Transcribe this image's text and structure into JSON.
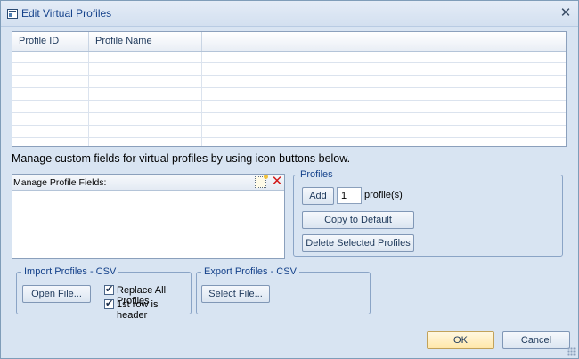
{
  "window": {
    "title": "Edit Virtual Profiles",
    "close_icon": "close-icon"
  },
  "grid": {
    "columns": [
      "Profile ID",
      "Profile Name"
    ],
    "rows": []
  },
  "caption": "Manage custom fields for virtual profiles by using icon buttons below.",
  "manage_fields": {
    "label": "Manage Profile Fields:",
    "icons": [
      "new-field-icon",
      "delete-icon"
    ]
  },
  "profiles_group": {
    "legend": "Profiles",
    "add_label": "Add",
    "count_value": "1",
    "count_suffix": "profile(s)",
    "copy_default_label": "Copy to Default",
    "delete_selected_label": "Delete Selected Profiles"
  },
  "import_group": {
    "legend": "Import Profiles - CSV",
    "open_file_label": "Open File...",
    "replace_all_label": "Replace All Profiles",
    "replace_all_checked": true,
    "first_row_header_label": "1st row is header",
    "first_row_header_checked": true
  },
  "export_group": {
    "legend": "Export Profiles - CSV",
    "select_file_label": "Select File..."
  },
  "footer": {
    "ok_label": "OK",
    "cancel_label": "Cancel"
  }
}
